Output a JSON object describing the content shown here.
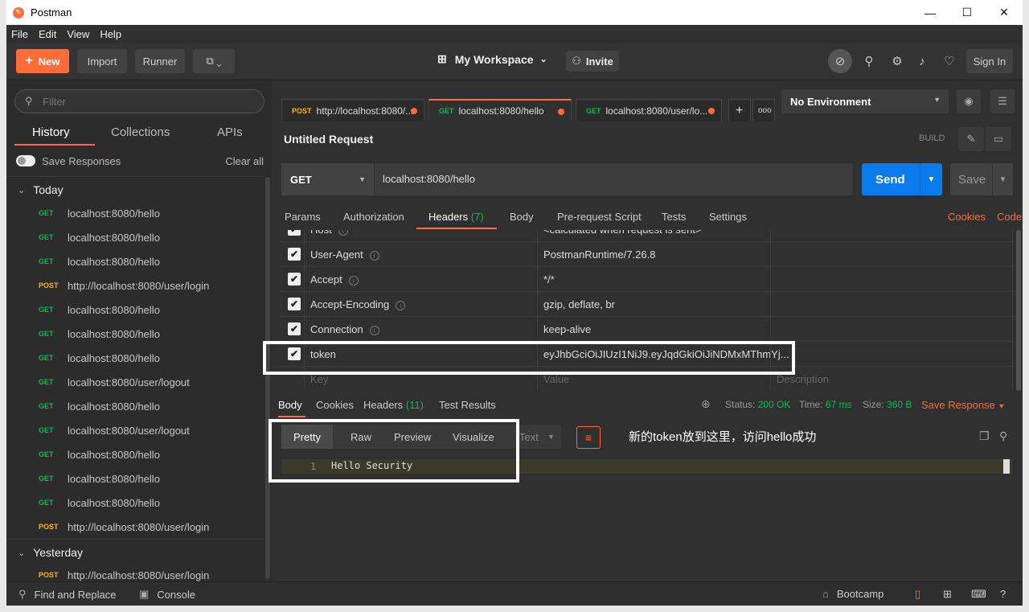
{
  "window": {
    "title": "Postman",
    "minimize": "—",
    "maximize": "☐",
    "close": "✕"
  },
  "menu": [
    "File",
    "Edit",
    "View",
    "Help"
  ],
  "toolbar": {
    "new_label": "New",
    "import_label": "Import",
    "runner_label": "Runner",
    "workspace_label": "My Workspace",
    "invite_label": "Invite",
    "signin_label": "Sign In"
  },
  "sidebar": {
    "filter_placeholder": "Filter",
    "tabs": [
      "History",
      "Collections",
      "APIs"
    ],
    "save_responses": "Save Responses",
    "clear_all": "Clear all",
    "group_today": "Today",
    "group_yesterday": "Yesterday",
    "history": [
      {
        "method": "GET",
        "url": "localhost:8080/hello"
      },
      {
        "method": "GET",
        "url": "localhost:8080/hello"
      },
      {
        "method": "GET",
        "url": "localhost:8080/hello"
      },
      {
        "method": "POST",
        "url": "http://localhost:8080/user/login"
      },
      {
        "method": "GET",
        "url": "localhost:8080/hello"
      },
      {
        "method": "GET",
        "url": "localhost:8080/hello"
      },
      {
        "method": "GET",
        "url": "localhost:8080/hello"
      },
      {
        "method": "GET",
        "url": "localhost:8080/user/logout"
      },
      {
        "method": "GET",
        "url": "localhost:8080/hello"
      },
      {
        "method": "GET",
        "url": "localhost:8080/user/logout"
      },
      {
        "method": "GET",
        "url": "localhost:8080/hello"
      },
      {
        "method": "GET",
        "url": "localhost:8080/hello"
      },
      {
        "method": "GET",
        "url": "localhost:8080/hello"
      },
      {
        "method": "POST",
        "url": "http://localhost:8080/user/login"
      }
    ],
    "yesterday_item": {
      "method": "POST",
      "url": "http://localhost:8080/user/login"
    }
  },
  "request_tabs": [
    {
      "method": "POST",
      "label": "http://localhost:8080/..."
    },
    {
      "method": "GET",
      "label": "localhost:8080/hello"
    },
    {
      "method": "GET",
      "label": "localhost:8080/user/lo..."
    }
  ],
  "environment": "No Environment",
  "request": {
    "name": "Untitled Request",
    "build": "BUILD",
    "method": "GET",
    "url": "localhost:8080/hello",
    "send": "Send",
    "save": "Save"
  },
  "param_tabs": {
    "params": "Params",
    "authorization": "Authorization",
    "headers": "Headers",
    "headers_count": "(7)",
    "body": "Body",
    "prerequest": "Pre-request Script",
    "tests": "Tests",
    "settings": "Settings",
    "cookies": "Cookies",
    "code": "Code"
  },
  "headers": [
    {
      "key": "Host",
      "value": "<calculated when request is sent>"
    },
    {
      "key": "User-Agent",
      "value": "PostmanRuntime/7.26.8"
    },
    {
      "key": "Accept",
      "value": "*/*"
    },
    {
      "key": "Accept-Encoding",
      "value": "gzip, deflate, br"
    },
    {
      "key": "Connection",
      "value": "keep-alive"
    },
    {
      "key": "token",
      "value": "eyJhbGciOiJIUzI1NiJ9.eyJqdGkiOiJiNDMxMThmYj..."
    }
  ],
  "header_placeholders": {
    "key": "Key",
    "value": "Value",
    "description": "Description"
  },
  "response": {
    "tabs": {
      "body": "Body",
      "cookies": "Cookies",
      "headers": "Headers",
      "headers_count": "(11)",
      "test_results": "Test Results"
    },
    "status_label": "Status:",
    "status": "200 OK",
    "time_label": "Time:",
    "time": "67 ms",
    "size_label": "Size:",
    "size": "360 B",
    "save_response": "Save Response",
    "formats": [
      "Pretty",
      "Raw",
      "Preview",
      "Visualize"
    ],
    "text_select": "Text",
    "line_number": "1",
    "body_text": "Hello Security",
    "annotation": "新的token放到这里，访问hello成功"
  },
  "footer": {
    "find_replace": "Find and Replace",
    "console": "Console",
    "bootcamp": "Bootcamp"
  },
  "colors": {
    "accent": "#ff6c37",
    "send": "#097bed",
    "get": "#0cbb52",
    "post": "#ffb400"
  }
}
